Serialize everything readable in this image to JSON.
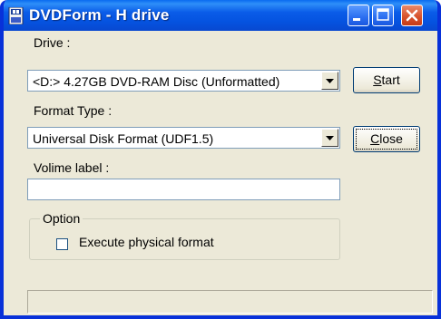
{
  "window": {
    "title": "DVDForm - H drive",
    "colors": {
      "titlebar": "#0553e0",
      "face": "#ece9d8",
      "close": "#d8542e"
    }
  },
  "drive": {
    "label": "Drive :",
    "selected": "<D:> 4.27GB DVD-RAM Disc (Unformatted)"
  },
  "format_type": {
    "label": "Format Type :",
    "selected": "Universal Disk Format (UDF1.5)"
  },
  "volume_label": {
    "label": "Volime label :",
    "value": ""
  },
  "option": {
    "legend": "Option",
    "execute_physical_format": {
      "label": "Execute physical format",
      "checked": false
    }
  },
  "buttons": {
    "start": {
      "pre": "",
      "mnemonic": "S",
      "post": "tart"
    },
    "close": {
      "pre": "",
      "mnemonic": "C",
      "post": "lose"
    }
  },
  "status_bar": {
    "text": ""
  },
  "icons": {
    "app": "dvd-app-icon",
    "minimize": "minimize-icon",
    "maximize": "maximize-icon",
    "close": "close-icon",
    "dropdown": "chevron-down-icon"
  }
}
